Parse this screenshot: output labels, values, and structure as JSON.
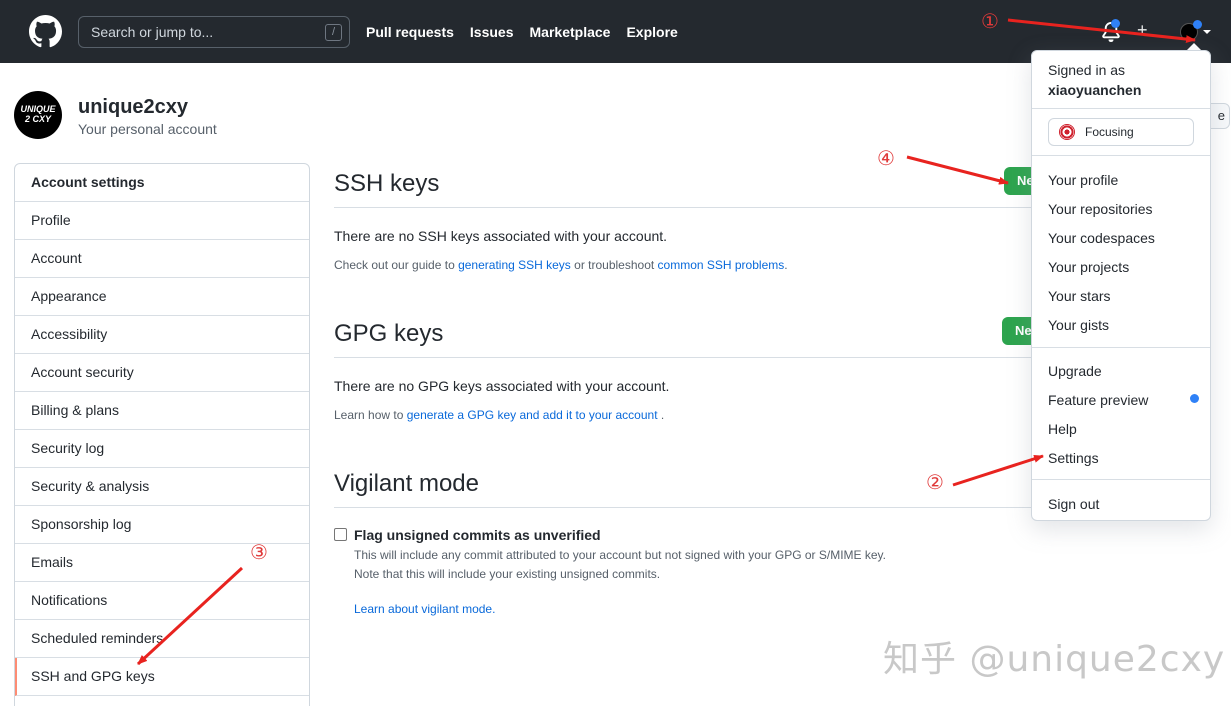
{
  "header": {
    "search_placeholder": "Search or jump to...",
    "search_shortcut": "/",
    "nav": [
      "Pull requests",
      "Issues",
      "Marketplace",
      "Explore"
    ],
    "plus": "+"
  },
  "account": {
    "avatar_text_line1": "UNIQUE",
    "avatar_text_line2": "2 CXY",
    "name": "unique2cxy",
    "subtitle": "Your personal account",
    "partial_button": "e"
  },
  "sidebar": {
    "heading": "Account settings",
    "items": [
      "Profile",
      "Account",
      "Appearance",
      "Accessibility",
      "Account security",
      "Billing & plans",
      "Security log",
      "Security & analysis",
      "Sponsorship log",
      "Emails",
      "Notifications",
      "Scheduled reminders",
      "SSH and GPG keys"
    ],
    "active_item": "SSH and GPG keys"
  },
  "ssh": {
    "title": "SSH keys",
    "button_label": "Ne",
    "empty": "There are no SSH keys associated with your account.",
    "help_prefix": "Check out our guide to ",
    "help_link1": "generating SSH keys",
    "help_mid": " or troubleshoot ",
    "help_link2": "common SSH problems",
    "help_suffix": "."
  },
  "gpg": {
    "title": "GPG keys",
    "button_label": "Ne",
    "empty": "There are no GPG keys associated with your account.",
    "help_prefix": "Learn how to ",
    "help_link": "generate a GPG key and add it to your account",
    "help_suffix": " ."
  },
  "vigilant": {
    "title": "Vigilant mode",
    "checkbox_label": "Flag unsigned commits as unverified",
    "checked": false,
    "desc_line1": "This will include any commit attributed to your account but not signed with your GPG or S/MIME key.",
    "desc_line2": "Note that this will include your existing unsigned commits.",
    "learn_link": "Learn about vigilant mode."
  },
  "dropdown": {
    "signed_in_as": "Signed in as",
    "username": "xiaoyuanchen",
    "status": "Focusing",
    "group1": [
      "Your profile",
      "Your repositories",
      "Your codespaces",
      "Your projects",
      "Your stars",
      "Your gists"
    ],
    "group2": [
      "Upgrade",
      "Feature preview",
      "Help",
      "Settings"
    ],
    "sign_out": "Sign out"
  },
  "annotations": {
    "marker1": "①",
    "marker2": "②",
    "marker3": "③",
    "marker4": "④",
    "arrow_color": "#e8231f"
  },
  "watermark": "知乎 @unique2cxy",
  "colors": {
    "header_bg": "#24292f",
    "green": "#2da44e",
    "link": "#0969da",
    "active_border": "#fd8c73",
    "notification_dot": "#2f81f7"
  }
}
